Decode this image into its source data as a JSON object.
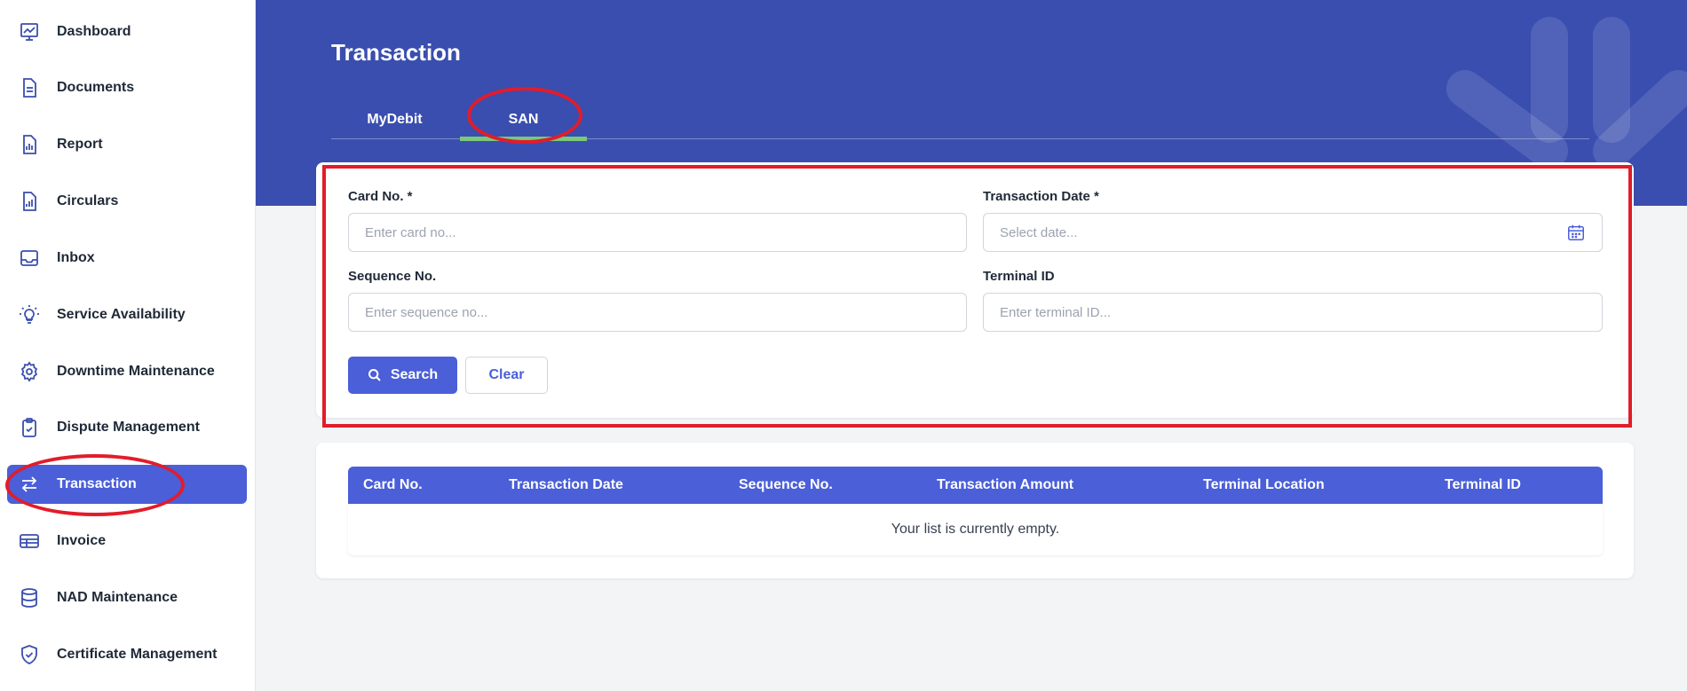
{
  "sidebar": {
    "items": [
      {
        "label": "Dashboard",
        "icon": "dashboard-chart-icon"
      },
      {
        "label": "Documents",
        "icon": "document-icon"
      },
      {
        "label": "Report",
        "icon": "report-icon"
      },
      {
        "label": "Circulars",
        "icon": "circulars-icon"
      },
      {
        "label": "Inbox",
        "icon": "inbox-icon"
      },
      {
        "label": "Service Availability",
        "icon": "lightbulb-icon"
      },
      {
        "label": "Downtime Maintenance",
        "icon": "gear-icon"
      },
      {
        "label": "Dispute Management",
        "icon": "clipboard-icon"
      },
      {
        "label": "Transaction",
        "icon": "transfer-arrows-icon",
        "active": true
      },
      {
        "label": "Invoice",
        "icon": "invoice-icon"
      },
      {
        "label": "NAD Maintenance",
        "icon": "database-icon"
      },
      {
        "label": "Certificate Management",
        "icon": "shield-check-icon"
      }
    ]
  },
  "header": {
    "title": "Transaction",
    "tabs": [
      {
        "label": "MyDebit"
      },
      {
        "label": "SAN",
        "active": true
      }
    ]
  },
  "search_form": {
    "card_no": {
      "label": "Card No. *",
      "placeholder": "Enter card no..."
    },
    "transaction_date": {
      "label": "Transaction Date *",
      "placeholder": "Select date..."
    },
    "sequence_no": {
      "label": "Sequence No.",
      "placeholder": "Enter sequence no..."
    },
    "terminal_id": {
      "label": "Terminal ID",
      "placeholder": "Enter terminal ID..."
    },
    "search_label": "Search",
    "clear_label": "Clear"
  },
  "results_table": {
    "columns": [
      "Card No.",
      "Transaction Date",
      "Sequence No.",
      "Transaction Amount",
      "Terminal Location",
      "Terminal ID"
    ],
    "empty_message": "Your list is currently empty."
  },
  "colors": {
    "banner": "#3a4eaf",
    "accent": "#4a5fd8",
    "tab_underline": "#7ac97a",
    "annotation": "#e21c2a"
  }
}
